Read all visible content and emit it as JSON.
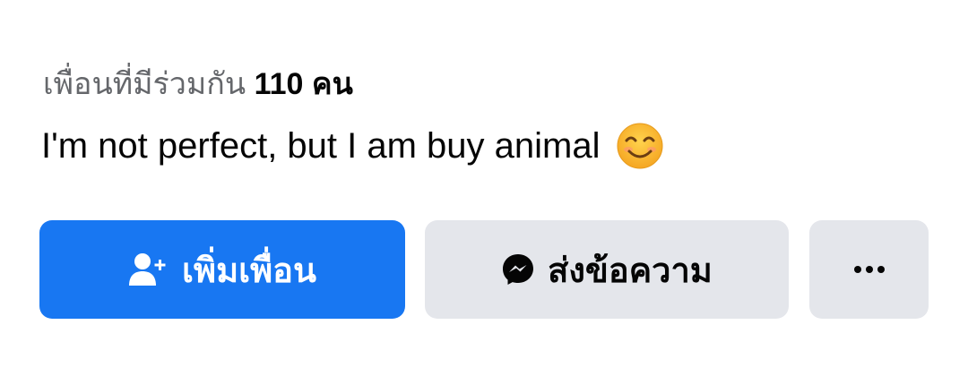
{
  "profile": {
    "name": "",
    "nickname": ""
  },
  "mutual_friends": {
    "label": "เพื่อนที่มีร่วมกัน",
    "count": "110",
    "unit": "คน"
  },
  "bio": {
    "text": "I'm not perfect, but I am buy animal",
    "emoji": "smiling-face-emoji"
  },
  "actions": {
    "add_friend": {
      "label": "เพิ่มเพื่อน",
      "icon": "add-friend-icon"
    },
    "message": {
      "label": "ส่งข้อความ",
      "icon": "messenger-icon"
    },
    "more": {
      "label": "···",
      "icon": "more-icon"
    }
  },
  "colors": {
    "primary": "#1877f2",
    "secondary_bg": "#e4e6eb",
    "muted_text": "#65676b",
    "text": "#050505"
  }
}
